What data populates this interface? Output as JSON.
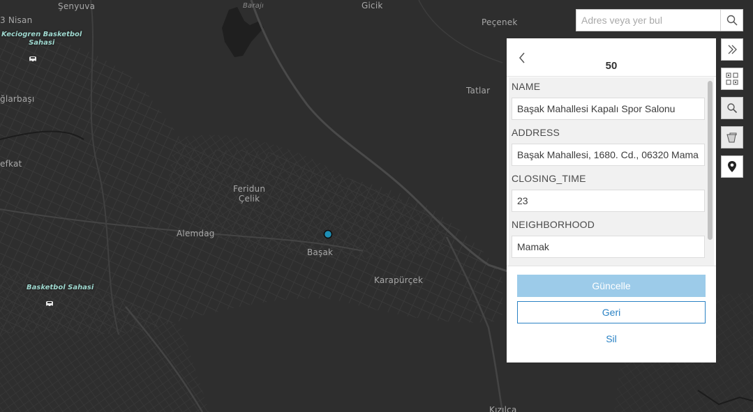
{
  "map": {
    "labels": {
      "senyuva": "Şenyuva",
      "baraji": "Barajı",
      "gicik": "Gicik",
      "pecenek": "Peçenek",
      "nisan": "3 Nisan",
      "baglarbasi": "ğlarbaşı",
      "tatlar": "Tatlar",
      "efkat": "efkat",
      "feridun_celik": "Feridun\nÇelik",
      "alemdag": "Alemdag",
      "basak": "Başak",
      "karapurcek": "Karapürçek",
      "kizilca": "Kızılca"
    },
    "pois": {
      "keciogren": "Keciogren Basketbol\nSahasi",
      "basketbol": "Basketbol Sahasi"
    },
    "selected_point_color": "#1e8fb5"
  },
  "search": {
    "placeholder": "Adres veya yer bul"
  },
  "toolbar": {
    "icons": [
      "double-chevron-right-icon",
      "qr-grid-icon",
      "magnifier-icon",
      "basket-icon",
      "map-pin-icon"
    ]
  },
  "panel": {
    "title": "50",
    "fields": [
      {
        "label": "NAME",
        "value": "Başak Mahallesi Kapalı Spor Salonu"
      },
      {
        "label": "ADDRESS",
        "value": "Başak Mahallesi, 1680. Cd., 06320 Mama"
      },
      {
        "label": "CLOSING_TIME",
        "value": "23"
      },
      {
        "label": "NEIGHBORHOOD",
        "value": "Mamak"
      }
    ],
    "buttons": {
      "update": "Güncelle",
      "back": "Geri",
      "delete": "Sil"
    }
  },
  "colors": {
    "accent": "#2a82c4",
    "update_button": "#9ccbe9",
    "map_background": "#2e2e2e"
  }
}
